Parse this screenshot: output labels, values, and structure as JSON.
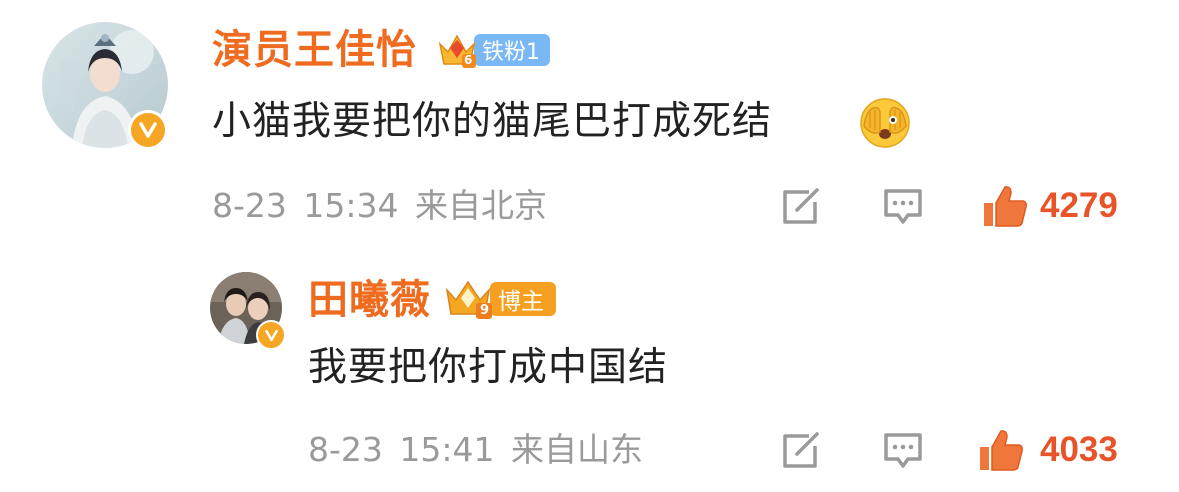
{
  "comments": [
    {
      "username": "演员王佳怡",
      "badge_label": "铁粉1",
      "badge_level": "6",
      "content": "小猫我要把你的猫尾巴打成死结",
      "emoji": "covering-face-emoji",
      "date": "8-23",
      "time": "15:34",
      "location": "来自北京",
      "likes": "4279",
      "icons": {
        "share": "share-icon",
        "reply": "reply-icon",
        "like": "thumbs-up-icon",
        "verified": "verified-v-icon"
      }
    },
    {
      "username": "田曦薇",
      "badge_label": "博主",
      "badge_level": "9",
      "content": "我要把你打成中国结",
      "date": "8-23",
      "time": "15:41",
      "location": "来自山东",
      "likes": "4033",
      "icons": {
        "share": "share-icon",
        "reply": "reply-icon",
        "like": "thumbs-up-icon",
        "verified": "verified-v-icon"
      }
    }
  ],
  "colors": {
    "username": "#ee6b1f",
    "like_count": "#e8542a",
    "meta_text": "#9a9a9a",
    "content_text": "#222222",
    "fan_badge": "#7ab8f5",
    "blogger_badge": "#f5a020",
    "verified": "#f5a623"
  }
}
